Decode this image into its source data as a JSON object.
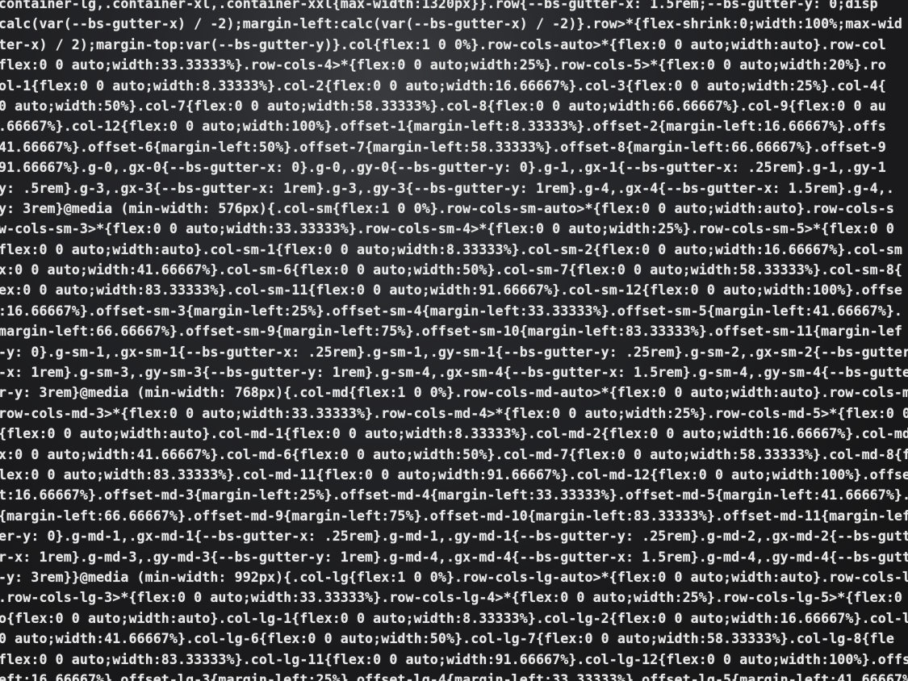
{
  "code_lines": [
    "container-lg,.container-xl,.container-xxl{max-width:1320px}}.row{--bs-gutter-x: 1.5rem;--bs-gutter-y: 0;disp",
    "calc(var(--bs-gutter-x) / -2);margin-left:calc(var(--bs-gutter-x) / -2)}.row>*{flex-shrink:0;width:100%;max-wid",
    "ter-x) / 2);margin-top:var(--bs-gutter-y)}.col{flex:1 0 0%}.row-cols-auto>*{flex:0 0 auto;width:auto}.row-col",
    "flex:0 0 auto;width:33.33333%}.row-cols-4>*{flex:0 0 auto;width:25%}.row-cols-5>*{flex:0 0 auto;width:20%}.ro",
    "ol-1{flex:0 0 auto;width:8.33333%}.col-2{flex:0 0 auto;width:16.66667%}.col-3{flex:0 0 auto;width:25%}.col-4{",
    "0 auto;width:50%}.col-7{flex:0 0 auto;width:58.33333%}.col-8{flex:0 0 auto;width:66.66667%}.col-9{flex:0 0 au",
    ".66667%}.col-12{flex:0 0 auto;width:100%}.offset-1{margin-left:8.33333%}.offset-2{margin-left:16.66667%}.offs",
    "41.66667%}.offset-6{margin-left:50%}.offset-7{margin-left:58.33333%}.offset-8{margin-left:66.66667%}.offset-9",
    "91.66667%}.g-0,.gx-0{--bs-gutter-x: 0}.g-0,.gy-0{--bs-gutter-y: 0}.g-1,.gx-1{--bs-gutter-x: .25rem}.g-1,.gy-1",
    "y: .5rem}.g-3,.gx-3{--bs-gutter-x: 1rem}.g-3,.gy-3{--bs-gutter-y: 1rem}.g-4,.gx-4{--bs-gutter-x: 1.5rem}.g-4,.",
    "y: 3rem}@media (min-width: 576px){.col-sm{flex:1 0 0%}.row-cols-sm-auto>*{flex:0 0 auto;width:auto}.row-cols-s",
    "w-cols-sm-3>*{flex:0 0 auto;width:33.33333%}.row-cols-sm-4>*{flex:0 0 auto;width:25%}.row-cols-sm-5>*{flex:0 0",
    "flex:0 0 auto;width:auto}.col-sm-1{flex:0 0 auto;width:8.33333%}.col-sm-2{flex:0 0 auto;width:16.66667%}.col-sm",
    "x:0 0 auto;width:41.66667%}.col-sm-6{flex:0 0 auto;width:50%}.col-sm-7{flex:0 0 auto;width:58.33333%}.col-sm-8{",
    "ex:0 0 auto;width:83.33333%}.col-sm-11{flex:0 0 auto;width:91.66667%}.col-sm-12{flex:0 0 auto;width:100%}.offse",
    ":16.66667%}.offset-sm-3{margin-left:25%}.offset-sm-4{margin-left:33.33333%}.offset-sm-5{margin-left:41.66667%}.",
    "margin-left:66.66667%}.offset-sm-9{margin-left:75%}.offset-sm-10{margin-left:83.33333%}.offset-sm-11{margin-lef",
    "-y: 0}.g-sm-1,.gx-sm-1{--bs-gutter-x: .25rem}.g-sm-1,.gy-sm-1{--bs-gutter-y: .25rem}.g-sm-2,.gx-sm-2{--bs-gutter",
    "-x: 1rem}.g-sm-3,.gy-sm-3{--bs-gutter-y: 1rem}.g-sm-4,.gx-sm-4{--bs-gutter-x: 1.5rem}.g-sm-4,.gy-sm-4{--bs-gutte",
    "r-y: 3rem}@media (min-width: 768px){.col-md{flex:1 0 0%}.row-cols-md-auto>*{flex:0 0 auto;width:auto}.row-cols-m",
    "row-cols-md-3>*{flex:0 0 auto;width:33.33333%}.row-cols-md-4>*{flex:0 0 auto;width:25%}.row-cols-md-5>*{flex:0 0",
    "{flex:0 0 auto;width:auto}.col-md-1{flex:0 0 auto;width:8.33333%}.col-md-2{flex:0 0 auto;width:16.66667%}.col-md-",
    "x:0 0 auto;width:41.66667%}.col-md-6{flex:0 0 auto;width:50%}.col-md-7{flex:0 0 auto;width:58.33333%}.col-md-8{f",
    "lex:0 0 auto;width:83.33333%}.col-md-11{flex:0 0 auto;width:91.66667%}.col-md-12{flex:0 0 auto;width:100%}.offset",
    "t:16.66667%}.offset-md-3{margin-left:25%}.offset-md-4{margin-left:33.33333%}.offset-md-5{margin-left:41.66667%}.",
    "{margin-left:66.66667%}.offset-md-9{margin-left:75%}.offset-md-10{margin-left:83.33333%}.offset-md-11{margin-left:",
    "er-y: 0}.g-md-1,.gx-md-1{--bs-gutter-x: .25rem}.g-md-1,.gy-md-1{--bs-gutter-y: .25rem}.g-md-2,.gx-md-2{--bs-gutter-",
    "r-x: 1rem}.g-md-3,.gy-md-3{--bs-gutter-y: 1rem}.g-md-4,.gx-md-4{--bs-gutter-x: 1.5rem}.g-md-4,.gy-md-4{--bs-gutter",
    "-y: 3rem}}@media (min-width: 992px){.col-lg{flex:1 0 0%}.row-cols-lg-auto>*{flex:0 0 auto;width:auto}.row-cols-lg",
    ".row-cols-lg-3>*{flex:0 0 auto;width:33.33333%}.row-cols-lg-4>*{flex:0 0 auto;width:25%}.row-cols-lg-5>*{flex:0 0",
    "o{flex:0 0 auto;width:auto}.col-lg-1{flex:0 0 auto;width:8.33333%}.col-lg-2{flex:0 0 auto;width:16.66667%}.col-lg-3{",
    "0 auto;width:41.66667%}.col-lg-6{flex:0 0 auto;width:50%}.col-lg-7{flex:0 0 auto;width:58.33333%}.col-lg-8{fle",
    "flex:0 0 auto;width:83.33333%}.col-lg-11{flex:0 0 auto;width:91.66667%}.col-lg-12{flex:0 0 auto;width:100%}.offset-l",
    "eft:16.66667%}.offset-lg-3{margin-left:25%}.offset-lg-4{margin-left:33.33333%}.offset-lg-5{margin-left:41.66667%}.off"
  ],
  "colors": {
    "background": "#1a1a1c",
    "text": "#e9e9e9"
  }
}
